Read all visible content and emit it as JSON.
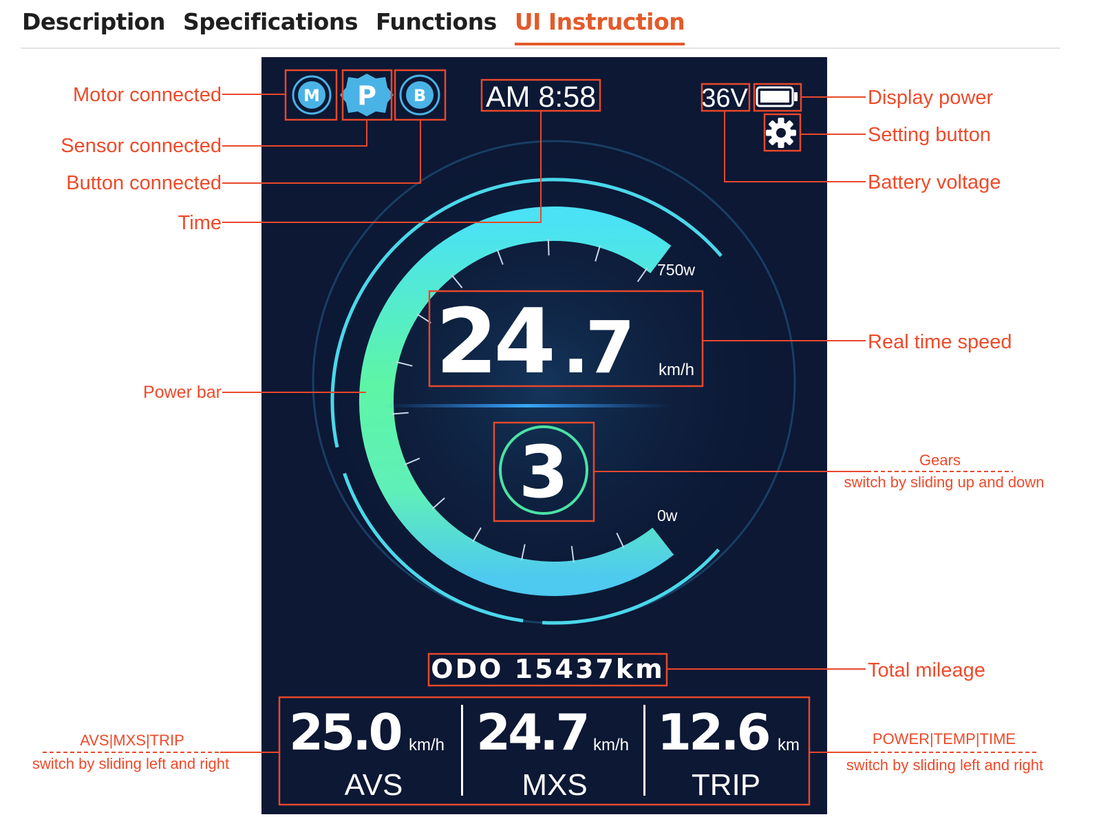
{
  "tabs": [
    {
      "label": "Description",
      "active": false
    },
    {
      "label": "Specifications",
      "active": false
    },
    {
      "label": "Functions",
      "active": false
    },
    {
      "label": "UI Instruction",
      "active": true
    }
  ],
  "colors": {
    "accent": "#e45a2a",
    "annotation": "#ee4a2a",
    "screen_bg": "#0c1834",
    "power_bar_top": "#4ae2f4",
    "power_bar_mid": "#5ef5a0",
    "power_bar_bottom": "#4ec9f0"
  },
  "display": {
    "status_icons": [
      {
        "name": "motor-icon",
        "glyph": "M"
      },
      {
        "name": "sensor-icon",
        "glyph": "P"
      },
      {
        "name": "button-icon",
        "glyph": "B"
      }
    ],
    "time": "AM 8:58",
    "voltage": "36V",
    "battery_icon": "battery-icon",
    "settings_icon": "gear-icon",
    "power_max_label": "750w",
    "power_min_label": "0w",
    "speed": {
      "int": "24",
      "dec": ".7",
      "unit": "km/h"
    },
    "gear": "3",
    "odometer": "ODO 15437km",
    "stats": [
      {
        "value": "25.0",
        "unit": "km/h",
        "label": "AVS"
      },
      {
        "value": "24.7",
        "unit": "km/h",
        "label": "MXS"
      },
      {
        "value": "12.6",
        "unit": "km",
        "label": "TRIP"
      }
    ]
  },
  "annotations": {
    "motor_connected": "Motor connected",
    "sensor_connected": "Sensor connected",
    "button_connected": "Button connected",
    "time": "Time",
    "power_bar": "Power bar",
    "display_power": "Display power",
    "setting_button": "Setting button",
    "battery_voltage": "Battery voltage",
    "real_time_speed": "Real time speed",
    "gears": "Gears",
    "gears_hint": "switch by sliding up and down",
    "total_mileage": "Total mileage",
    "left_stats_title": "AVS|MXS|TRIP",
    "left_stats_hint": "switch by sliding left and right",
    "right_stats_title": "POWER|TEMP|TIME",
    "right_stats_hint": "switch by sliding left and right"
  }
}
